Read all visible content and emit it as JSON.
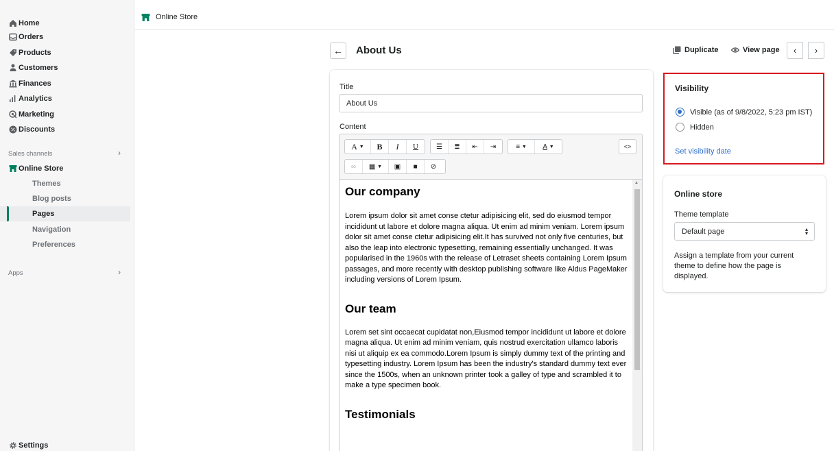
{
  "sidebar": {
    "items": [
      {
        "label": "Home",
        "icon": "home-icon"
      },
      {
        "label": "Orders",
        "icon": "orders-icon"
      },
      {
        "label": "Products",
        "icon": "tag-icon"
      },
      {
        "label": "Customers",
        "icon": "person-icon"
      },
      {
        "label": "Finances",
        "icon": "bank-icon"
      },
      {
        "label": "Analytics",
        "icon": "bar-chart-icon"
      },
      {
        "label": "Marketing",
        "icon": "target-icon"
      },
      {
        "label": "Discounts",
        "icon": "discount-icon"
      }
    ],
    "sales_channels_label": "Sales channels",
    "online_store": {
      "label": "Online Store",
      "icon": "store-icon"
    },
    "online_store_sub": [
      "Themes",
      "Blog posts",
      "Pages",
      "Navigation",
      "Preferences"
    ],
    "active_sub": "Pages",
    "apps_label": "Apps",
    "settings": {
      "label": "Settings",
      "icon": "gear-icon"
    },
    "accent_color": "#008060"
  },
  "topbar": {
    "breadcrumb": "Online Store"
  },
  "header": {
    "title": "About Us",
    "duplicate_label": "Duplicate",
    "view_page_label": "View page"
  },
  "main": {
    "title_label": "Title",
    "title_value": "About Us",
    "content_label": "Content",
    "editor": {
      "toolbar": [
        "A",
        "B",
        "I",
        "U"
      ],
      "sections": [
        {
          "heading": "Our company",
          "text": "Lorem ipsum dolor sit amet conse ctetur adipisicing elit, sed do eiusmod tempor incididunt ut labore et dolore magna aliqua. Ut enim ad minim veniam. Lorem ipsum dolor sit amet conse ctetur adipisicing elit.It has survived not only five centuries, but also the leap into electronic typesetting, remaining essentially unchanged. It was popularised in the 1960s with the release of Letraset sheets containing Lorem Ipsum passages, and more recently with desktop publishing software like Aldus PageMaker including versions of Lorem Ipsum."
        },
        {
          "heading": "Our team",
          "text": "Lorem set sint occaecat cupidatat non,Eiusmod tempor incididunt ut labore et dolore magna aliqua. Ut enim ad minim veniam, quis nostrud exercitation ullamco laboris nisi ut aliquip ex ea commodo.Lorem Ipsum is simply dummy text of the printing and typesetting industry. Lorem Ipsum has been the industry's standard dummy text ever since the 1500s, when an unknown printer took a galley of type and scrambled it to make a type specimen book."
        },
        {
          "heading": "Testimonials",
          "text": ""
        }
      ]
    }
  },
  "visibility": {
    "title": "Visibility",
    "visible_label": "Visible (as of 9/8/2022, 5:23 pm IST)",
    "hidden_label": "Hidden",
    "selected": "visible",
    "set_date_link": "Set visibility date",
    "highlight_color": "#d7191f"
  },
  "online_store_card": {
    "title": "Online store",
    "template_label": "Theme template",
    "template_value": "Default page",
    "help_text": "Assign a template from your current theme to define how the page is displayed."
  }
}
